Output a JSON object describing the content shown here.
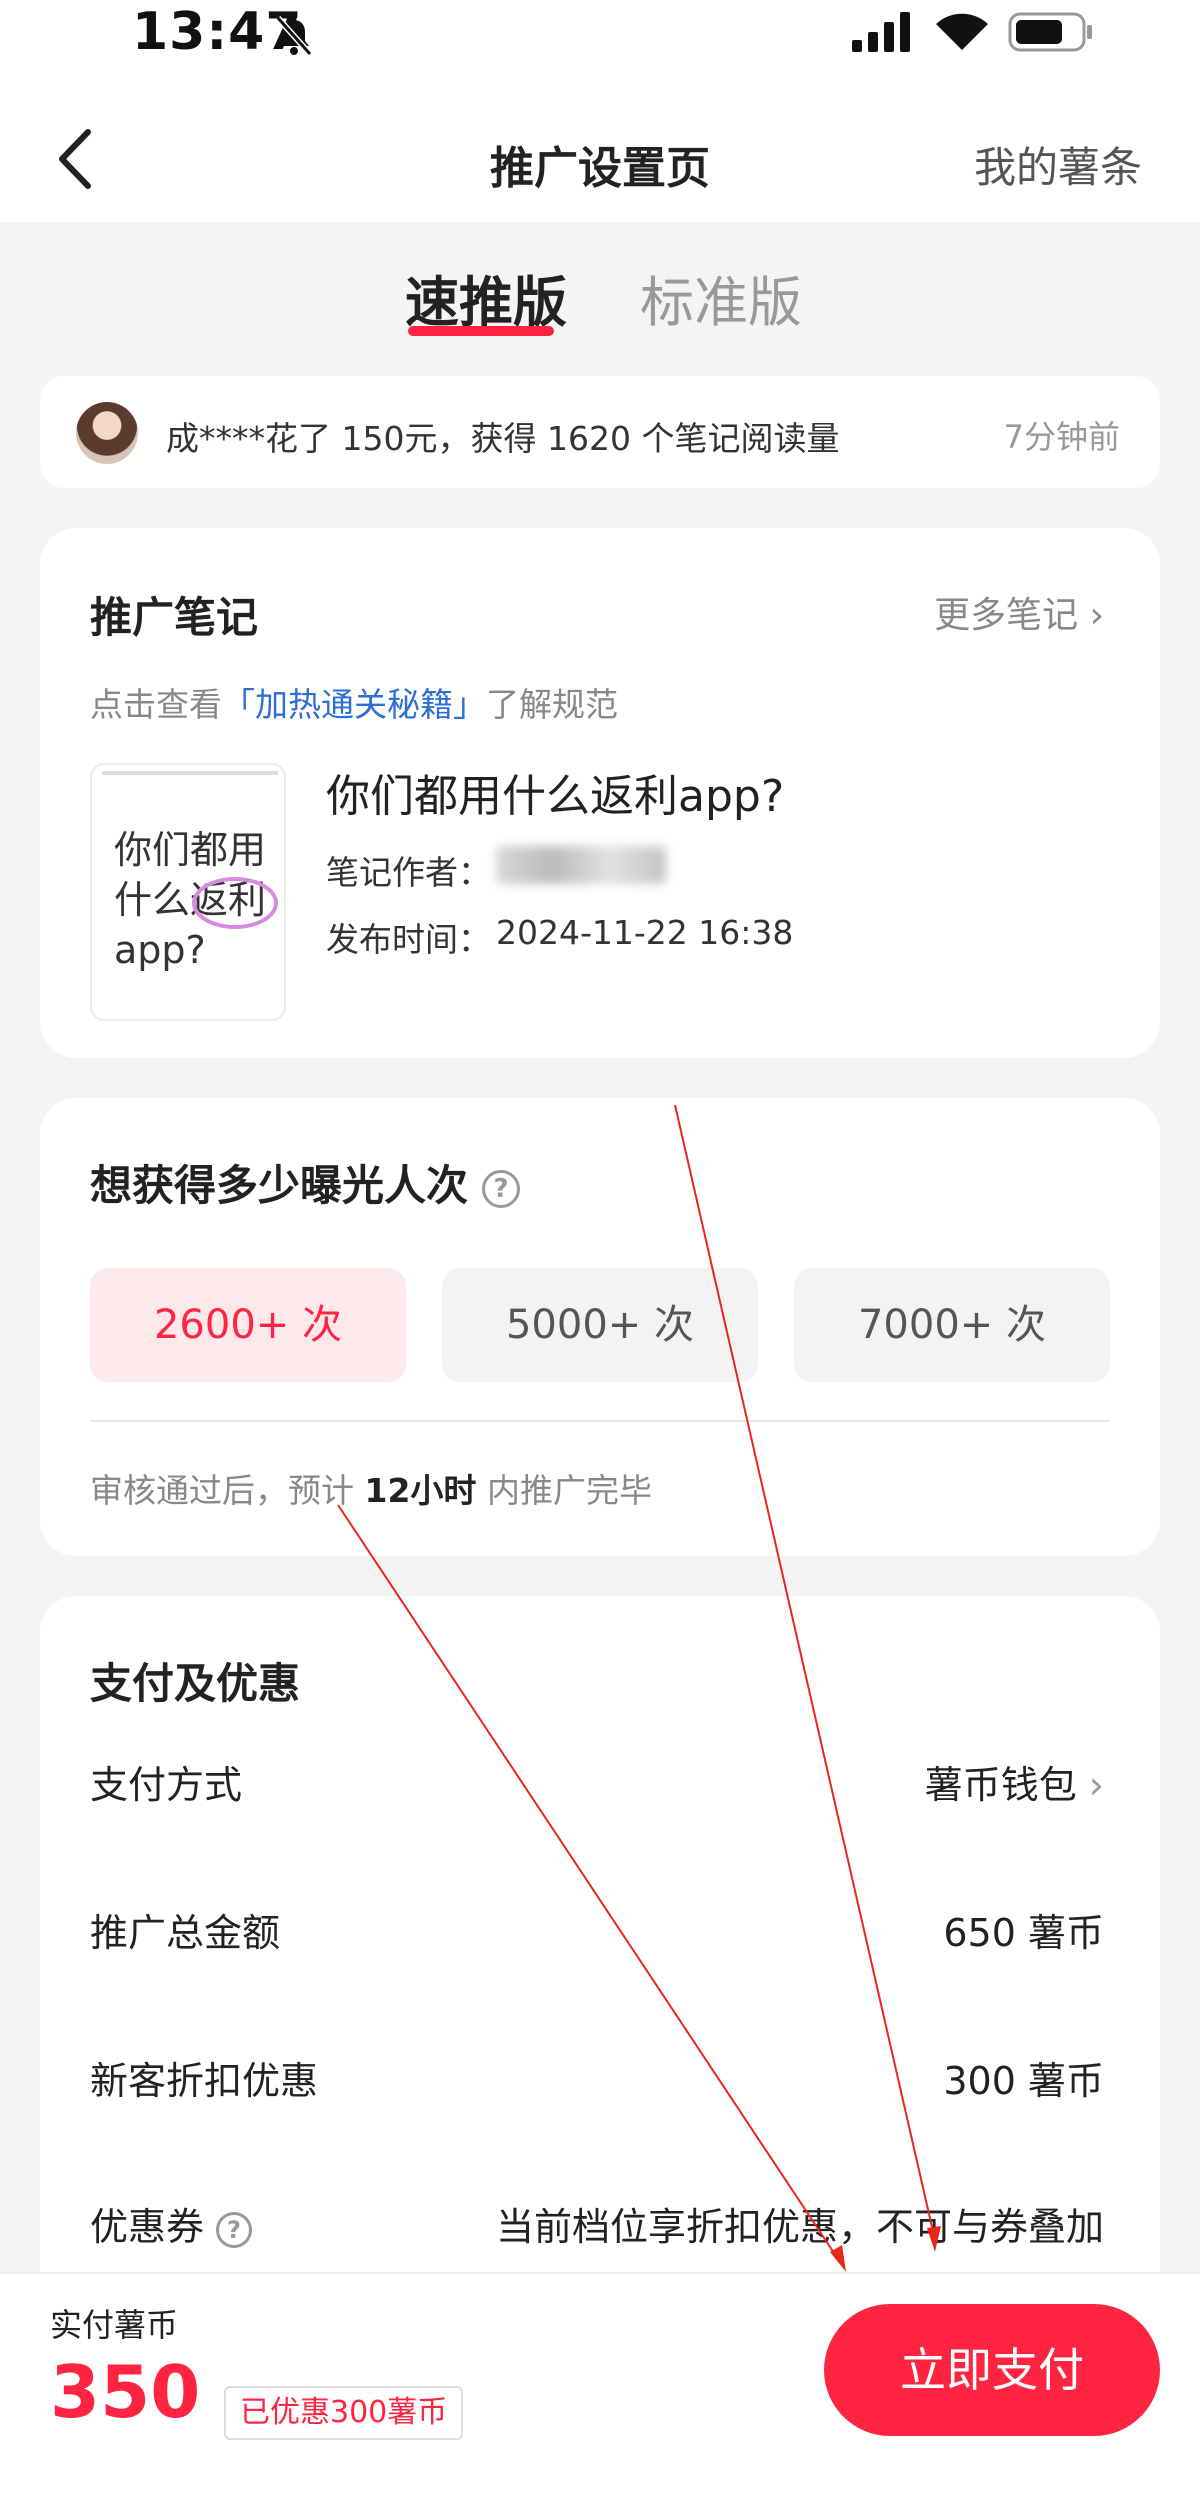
{
  "status_bar": {
    "time": "13:47"
  },
  "nav": {
    "title": "推广设置页",
    "right_link": "我的薯条"
  },
  "tabs": [
    {
      "label": "速推版",
      "active": true
    },
    {
      "label": "标准版",
      "active": false
    }
  ],
  "notice": {
    "text": "成****花了 150元，获得 1620 个笔记阅读量",
    "time": "7分钟前"
  },
  "note_section": {
    "title": "推广笔记",
    "more_label": "更多笔记",
    "hint_prefix": "点击查看",
    "hint_link": "「加热通关秘籍」",
    "hint_suffix": "了解规范",
    "thumbnail_text": "你们都用\n什么返利\napp?",
    "note_title": "你们都用什么返利app?",
    "author_label": "笔记作者：",
    "publish_label": "发布时间：",
    "publish_time": "2024-11-22 16:38"
  },
  "exposure": {
    "title": "想获得多少曝光人次",
    "options": [
      {
        "label": "2600+ 次",
        "selected": true
      },
      {
        "label": "5000+ 次",
        "selected": false
      },
      {
        "label": "7000+ 次",
        "selected": false
      }
    ],
    "note_prefix": "审核通过后，预计",
    "note_strong": "12小时",
    "note_suffix": "内推广完毕"
  },
  "payment": {
    "title": "支付及优惠",
    "method_label": "支付方式",
    "method_value": "薯币钱包",
    "total_label": "推广总金额",
    "total_value": "650 薯币",
    "discount_label": "新客折扣优惠",
    "discount_value": "300 薯币",
    "coupon_label": "优惠券",
    "coupon_value": "当前档位享折扣优惠，不可与券叠加"
  },
  "bottom": {
    "paid_label": "实付薯币",
    "paid_amount": "350",
    "saved_badge": "已优惠300薯币",
    "pay_button": "立即支付"
  },
  "colors": {
    "accent": "#ff2442",
    "link": "#2e6fd6",
    "background": "#f4f4f4"
  },
  "icons": [
    "back-chevron-icon",
    "bell-slash-icon",
    "signal-icon",
    "wifi-icon",
    "battery-icon",
    "chevron-right-icon",
    "help-icon"
  ]
}
